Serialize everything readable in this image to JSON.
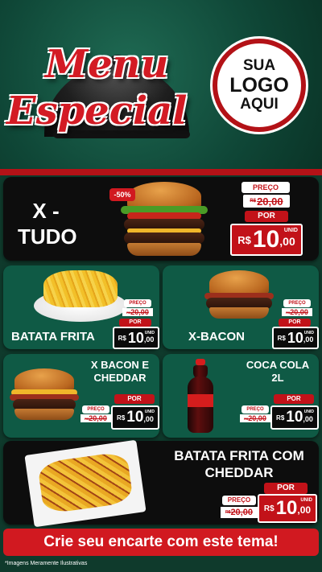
{
  "header": {
    "title_line1": "Menu",
    "title_line2": "Especial",
    "logo_line1": "SUA",
    "logo_line2": "LOGO",
    "logo_line3": "AQUI"
  },
  "labels": {
    "preco": "PREÇO",
    "por": "POR",
    "unid": "UNID",
    "currency": "R$"
  },
  "items": [
    {
      "name_line1": "X -",
      "name_line2": "TUDO",
      "badge": "-50%",
      "old_price": "20,00",
      "price_int": "10",
      "price_dec": ",00",
      "old_currency": "R$"
    },
    {
      "name": "BATATA FRITA",
      "old_price": "20,00",
      "price_int": "10",
      "price_dec": ",00",
      "old_currency": "R$"
    },
    {
      "name": "X-BACON",
      "old_price": "20,00",
      "price_int": "10",
      "price_dec": ",00",
      "old_currency": "R$"
    },
    {
      "name_line1": "X BACON E",
      "name_line2": "CHEDDAR",
      "old_price": "20,00",
      "price_int": "10",
      "price_dec": ",00",
      "old_currency": "R$"
    },
    {
      "name_line1": "COCA COLA",
      "name_line2": "2L",
      "old_price": "20,00",
      "price_int": "10",
      "price_dec": ",00",
      "old_currency": "R$"
    },
    {
      "name_line1": "BATATA FRITA COM",
      "name_line2": "CHEDDAR",
      "old_price": "20,00",
      "price_int": "10",
      "price_dec": ",00",
      "old_currency": "R$"
    }
  ],
  "cta": "Crie seu encarte com este tema!",
  "footnote": "*Imagens Meramente Ilustrativas",
  "colors": {
    "red": "#c21219",
    "green": "#0f5a45",
    "dark": "#0d0d0d"
  }
}
